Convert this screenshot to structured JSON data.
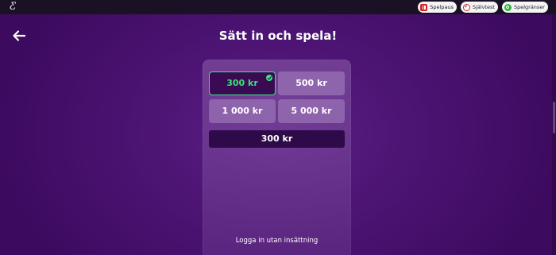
{
  "header": {
    "logo_glyph": "Ƹ",
    "pills": [
      {
        "label": "Spelpaus",
        "icon": "spelpaus-icon"
      },
      {
        "label": "Självtest",
        "icon": "sjalvtest-icon"
      },
      {
        "label": "Spelgränser",
        "icon": "spelgranser-icon"
      }
    ]
  },
  "page": {
    "title": "Sätt in och spela!",
    "back_icon": "arrow-left-icon"
  },
  "deposit": {
    "amounts": [
      {
        "label": "300 kr",
        "selected": true
      },
      {
        "label": "500 kr",
        "selected": false
      },
      {
        "label": "1 000 kr",
        "selected": false
      },
      {
        "label": "5 000 kr",
        "selected": false
      }
    ],
    "selected_value": "300 kr",
    "login_without_deposit": "Logga in utan insättning"
  },
  "colors": {
    "background": "#4d1474",
    "selected_border": "#3ee28a",
    "selected_text": "#39e27a",
    "topbar": "#1a1224"
  }
}
